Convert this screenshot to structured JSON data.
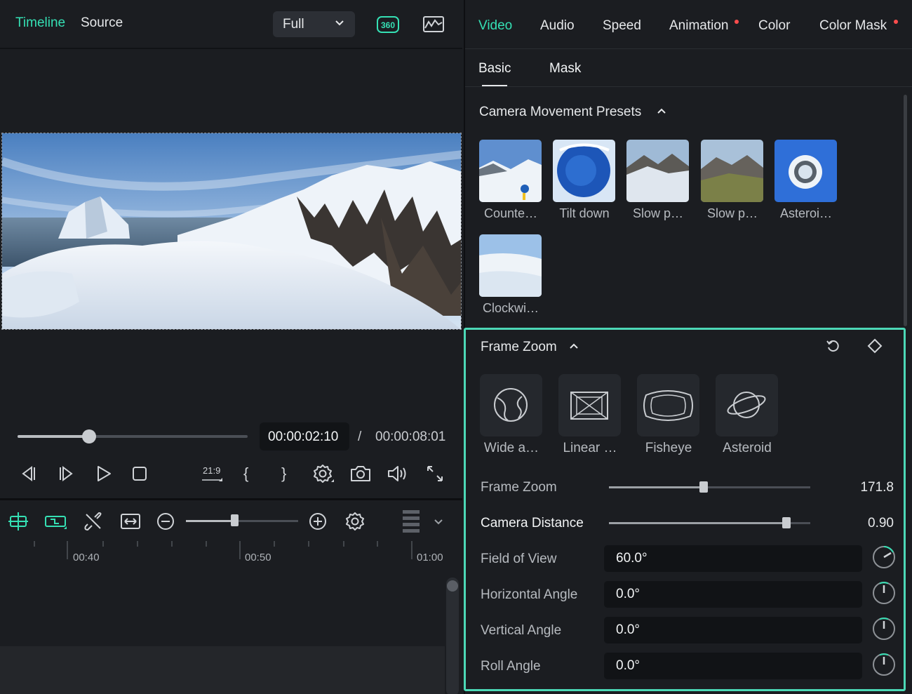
{
  "player": {
    "tabs": {
      "timeline": "Timeline",
      "source": "Source"
    },
    "quality": "Full",
    "progress_fraction": 0.31,
    "time_current": "00:00:02:10",
    "time_separator": "/",
    "time_total": "00:00:08:01",
    "controls": {
      "aspect_ratio": "21:9",
      "mark_in": "{",
      "mark_out": "}"
    }
  },
  "timeline": {
    "zoom_fraction": 0.43,
    "ruler": [
      "00:40",
      "00:50",
      "01:00"
    ]
  },
  "props": {
    "tabs": [
      "Video",
      "Audio",
      "Speed",
      "Animation",
      "Color",
      "Color Mask"
    ],
    "subtabs": [
      "Basic",
      "Mask"
    ],
    "presets": {
      "title": "Camera Movement Presets",
      "items": [
        "Counte…",
        "Tilt down",
        "Slow p…",
        "Slow p…",
        "Asteroi…",
        "Clockwi…"
      ]
    },
    "frame_zoom": {
      "title": "Frame Zoom",
      "modes": [
        "Wide a…",
        "Linear …",
        "Fisheye",
        "Asteroid"
      ],
      "frame_zoom_label": "Frame Zoom",
      "frame_zoom_value": "171.8",
      "frame_zoom_fraction": 0.47,
      "camera_distance_label": "Camera Distance",
      "camera_distance_value": "0.90",
      "camera_distance_fraction": 0.88,
      "fov_label": "Field of View",
      "fov_value": "60.0°",
      "horizontal_label": "Horizontal Angle",
      "horizontal_value": "0.0°",
      "vertical_label": "Vertical Angle",
      "vertical_value": "0.0°",
      "roll_label": "Roll Angle",
      "roll_value": "0.0°"
    }
  },
  "colors": {
    "accent": "#35e0b4",
    "panel_border": "#4cd8b6",
    "badge": "#ff4d4d"
  }
}
